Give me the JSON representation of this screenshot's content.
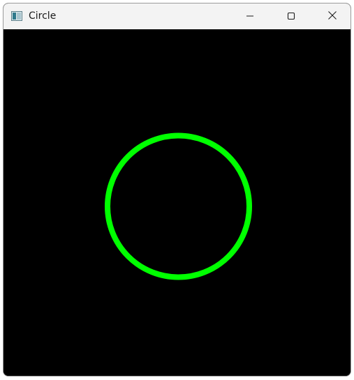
{
  "window": {
    "title": "Circle",
    "icon": "app-window-icon"
  },
  "titlebar": {
    "controls": [
      {
        "name": "minimize",
        "icon": "minimize-icon"
      },
      {
        "name": "maximize",
        "icon": "maximize-icon"
      },
      {
        "name": "close",
        "icon": "close-icon"
      }
    ]
  },
  "canvas": {
    "background_color": "#000000",
    "shape": "circle",
    "stroke_color": "#00ff00"
  }
}
